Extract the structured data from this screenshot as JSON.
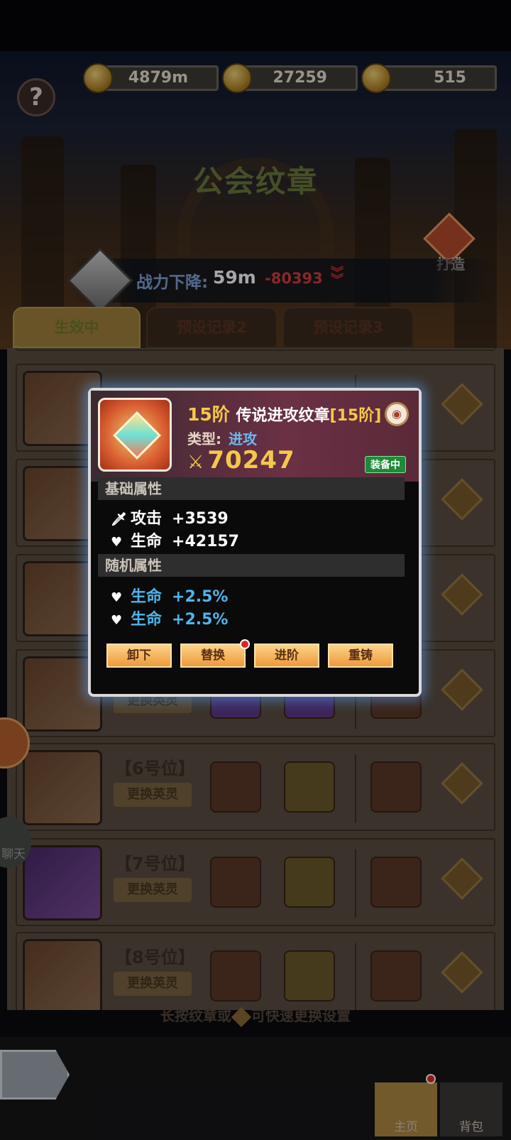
{
  "header": {
    "resources": [
      {
        "icon": "gold-coin-icon",
        "value": "4879m"
      },
      {
        "icon": "guild-coin-icon",
        "value": "27259"
      },
      {
        "icon": "key-token-icon",
        "value": "515"
      }
    ],
    "help_label": "?",
    "title": "公会纹章",
    "forge_label": "打造"
  },
  "power": {
    "label": "战力下降:",
    "value": "59m",
    "drop": "-80393"
  },
  "tabs": [
    {
      "label": "生效中",
      "active": true
    },
    {
      "label": "预设记录2",
      "active": false
    },
    {
      "label": "预设记录3",
      "active": false
    }
  ],
  "slots": [
    {
      "position": "",
      "change_label": ""
    },
    {
      "position": "",
      "change_label": ""
    },
    {
      "position": "",
      "change_label": ""
    },
    {
      "position": "",
      "change_label": "更换英灵"
    },
    {
      "position": "【6号位】",
      "change_label": "更换英灵"
    },
    {
      "position": "【7号位】",
      "change_label": "更换英灵"
    },
    {
      "position": "【8号位】",
      "change_label": "更换英灵"
    }
  ],
  "popup": {
    "tier": "15阶",
    "name": "传说进攻纹章",
    "tier_bracket": "[15阶]",
    "type_label": "类型:",
    "type_value": "进攻",
    "power": "70247",
    "equipped_badge": "装备中",
    "base_section": "基础属性",
    "base_stats": [
      {
        "icon": "sword-icon",
        "label": "攻击",
        "value": "+3539"
      },
      {
        "icon": "heart-icon",
        "label": "生命",
        "value": "+42157"
      }
    ],
    "random_section": "随机属性",
    "random_stats": [
      {
        "icon": "heart-icon",
        "label": "生命",
        "value": "+2.5%"
      },
      {
        "icon": "heart-icon",
        "label": "生命",
        "value": "+2.5%"
      }
    ],
    "buttons": [
      "卸下",
      "替换",
      "进阶",
      "重铸"
    ]
  },
  "side": {
    "chat_label": "聊天"
  },
  "hint": {
    "text_before": "长按纹章或",
    "text_after": "可快速更换设置"
  },
  "nav": {
    "home_label": "主页",
    "bag_label": "背包"
  },
  "colors": {
    "accent_gold": "#f5c84a",
    "stat_blue": "#4fb4ec",
    "drop_red": "#d23e3e",
    "equip_green": "#1f8a3a"
  }
}
